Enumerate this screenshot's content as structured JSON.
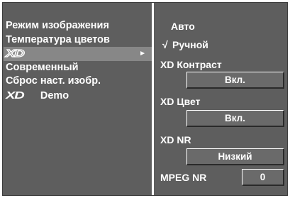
{
  "menu": {
    "items": [
      {
        "label": "Режим изображения"
      },
      {
        "label": "Температура цветов"
      },
      {
        "logo": "XD",
        "arrow": "►"
      },
      {
        "label": "Современный"
      },
      {
        "label": "Сброс наст. изобр."
      },
      {
        "logo": "XD",
        "label": "Demo"
      }
    ]
  },
  "submenu": {
    "mode_auto": "Авто",
    "mode_manual": "Ручной",
    "check": "√",
    "xd_contrast_label": "XD Контраст",
    "xd_contrast_value": "Вкл.",
    "xd_color_label": "XD Цвет",
    "xd_color_value": "Вкл.",
    "xd_nr_label": "XD NR",
    "xd_nr_value": "Низкий",
    "mpeg_nr_label": "MPEG NR",
    "mpeg_nr_value": "0"
  },
  "colors": {
    "panel_bg": "#5e5e5e",
    "highlight_bg": "#878787",
    "text": "#ffffff"
  }
}
